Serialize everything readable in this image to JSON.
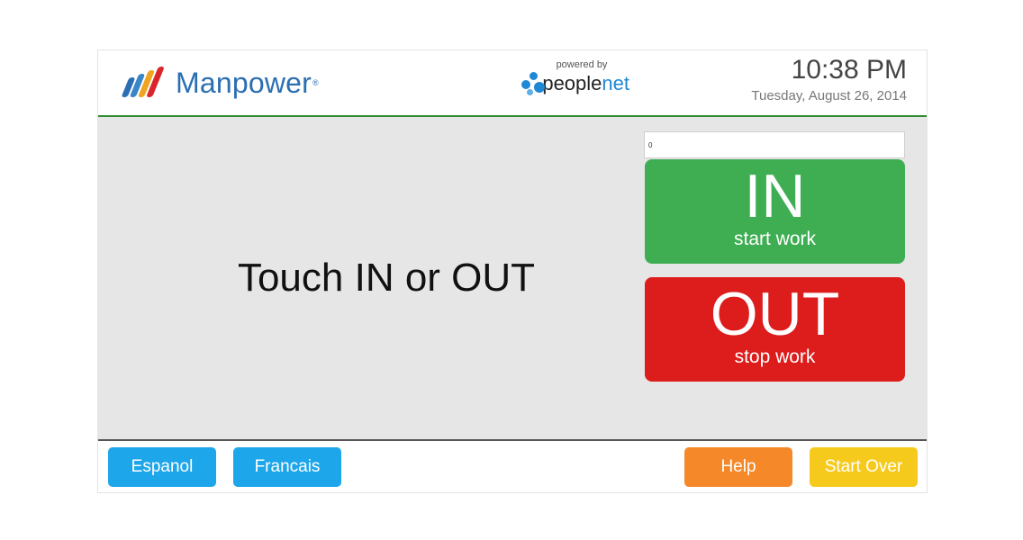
{
  "header": {
    "brand": "Manpower",
    "brand_mark": "®",
    "powered_by": "powered by",
    "partner_name_a": "people",
    "partner_name_b": "net",
    "time": "10:38 PM",
    "date": "Tuesday, August 26, 2014"
  },
  "main": {
    "prompt": "Touch IN or OUT",
    "entry_value": "0",
    "in_button": {
      "title": "IN",
      "subtitle": "start work",
      "color": "#3fae53"
    },
    "out_button": {
      "title": "OUT",
      "subtitle": "stop work",
      "color": "#dd1c1c"
    }
  },
  "footer": {
    "espanol": "Espanol",
    "francais": "Francais",
    "help": "Help",
    "start_over": "Start Over"
  },
  "colors": {
    "brand_blue": "#2b6fb2",
    "divider_green": "#2e8b2e",
    "language_blue": "#1ea6ea",
    "help_orange": "#f5892a",
    "start_over_yellow": "#f6ca1d"
  },
  "icons": {
    "brand_logo": "manpower-logo-icon",
    "partner_logo": "peoplenet-logo-icon"
  }
}
